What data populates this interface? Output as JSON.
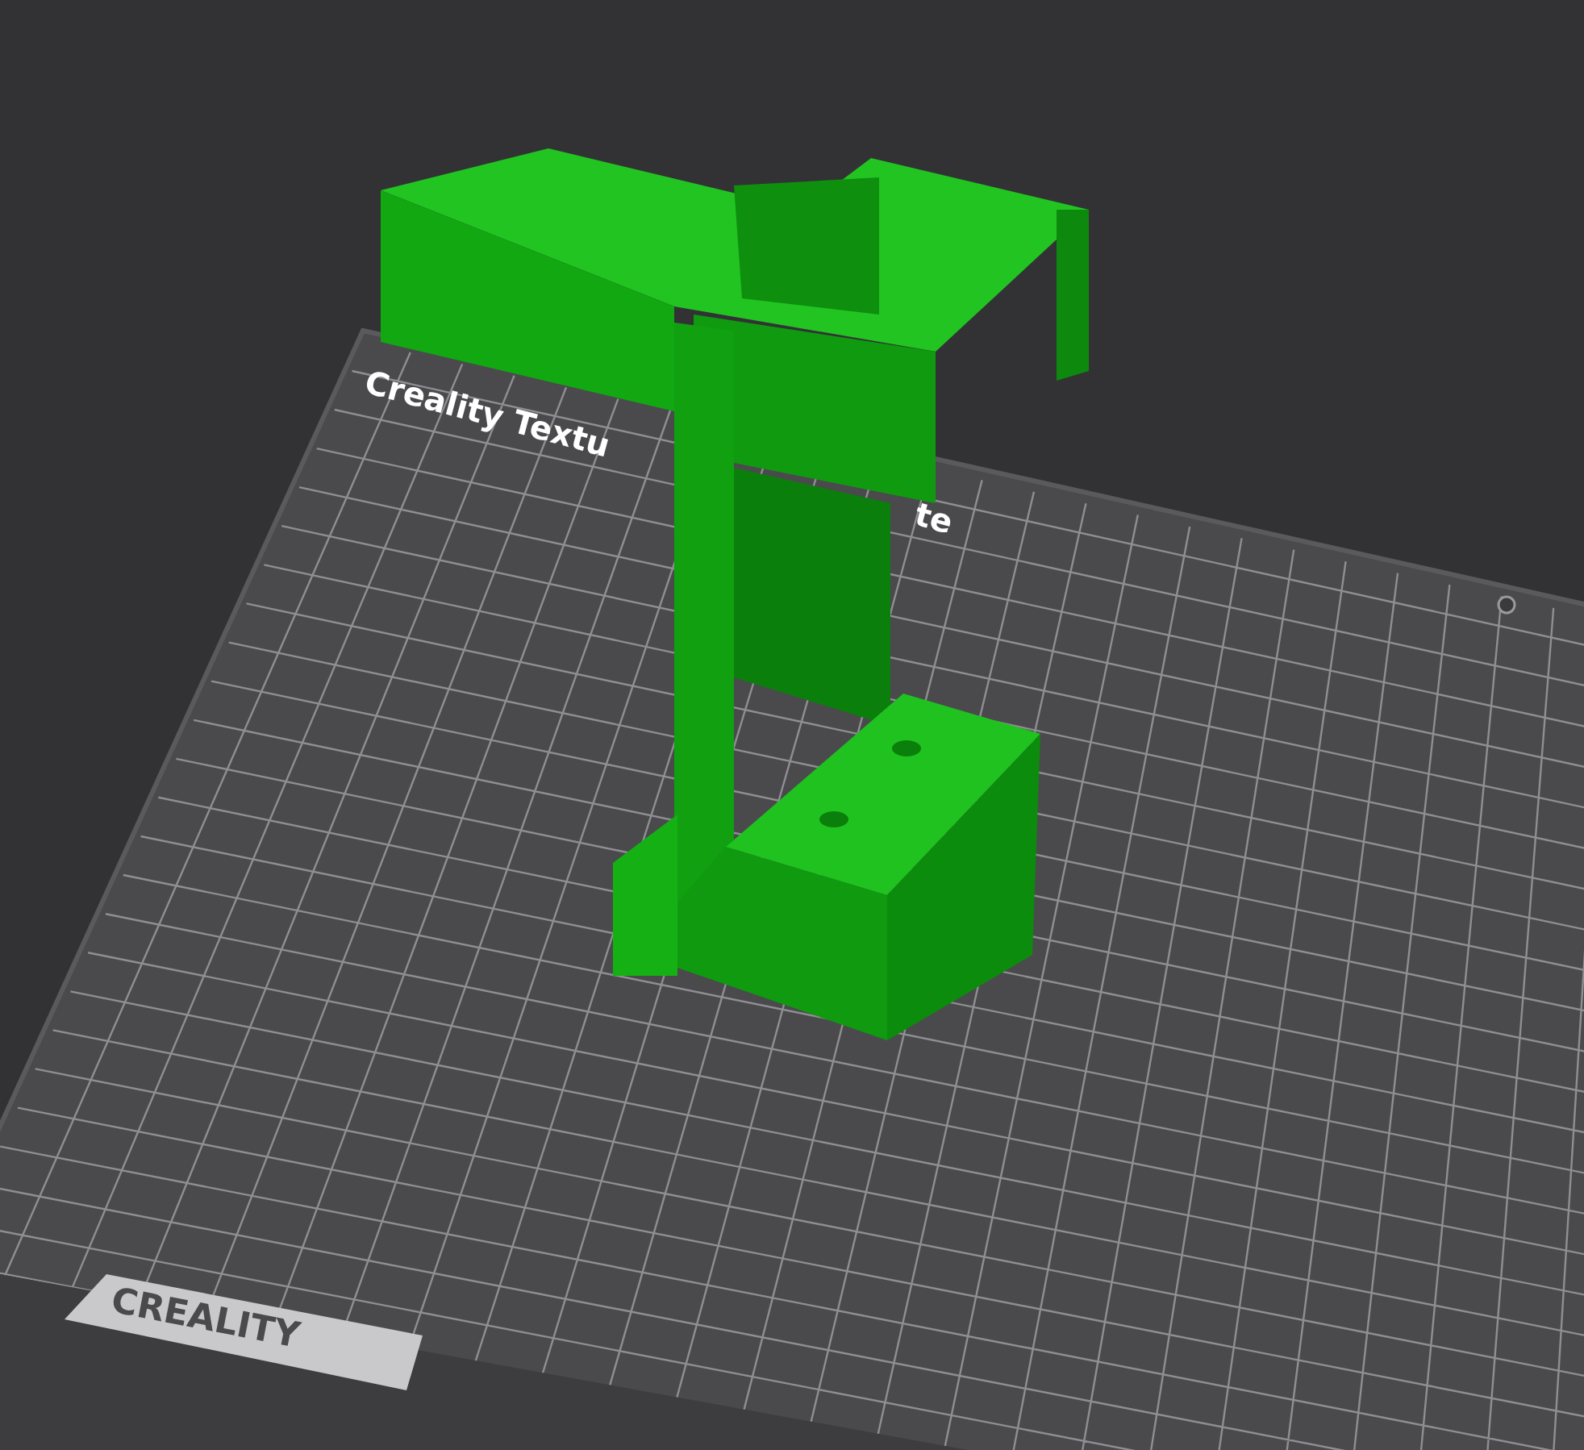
{
  "viewport": {
    "plate_labels": [
      {
        "text": "Creality Textu"
      },
      {
        "text": "te"
      }
    ],
    "plate_logo": "CREALITY"
  }
}
